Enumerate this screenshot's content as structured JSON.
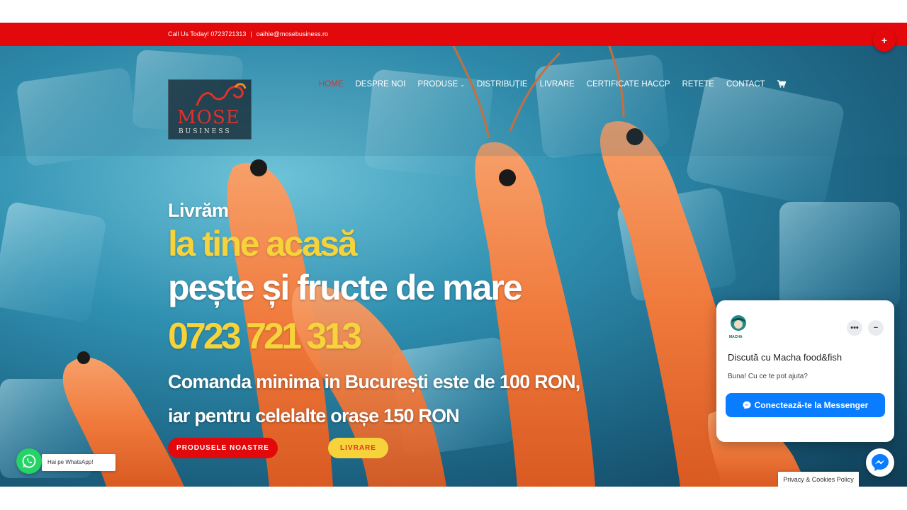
{
  "topbar": {
    "phone_text": "Call Us Today! 0723721313",
    "separator": "|",
    "email": "oaihie@mosebusiness.ro",
    "plus_label": "+"
  },
  "logo": {
    "main": "MOSE",
    "sub": "BUSINESS"
  },
  "nav": {
    "items": [
      {
        "label": "HOME",
        "active": true
      },
      {
        "label": "DESPRE NOI"
      },
      {
        "label": "PRODUSE",
        "has_dropdown": true
      },
      {
        "label": "DISTRIBUȚIE"
      },
      {
        "label": "LIVRARE"
      },
      {
        "label": "CERTIFICATE HACCP"
      },
      {
        "label": "RETETE"
      },
      {
        "label": "CONTACT"
      }
    ],
    "cart_icon": "cart-icon"
  },
  "hero": {
    "line1": "Livrăm",
    "line2": "la tine acasă",
    "line3": "pește și fructe de mare",
    "phone": "0723 721 313",
    "line4": "Comanda minima in București este de 100 RON,",
    "line5": "iar pentru celelalte orașe 150 RON",
    "btn_products": "PRODUSELE NOASTRE",
    "btn_delivery": "LIVRARE"
  },
  "whatsapp": {
    "label": "Hai pe WhatsApp!"
  },
  "chat": {
    "avatar_text": "MACHA",
    "title": "Discută cu Macha food&fish",
    "message": "Buna! Cu ce te pot ajuta?",
    "button": "Conectează-te la Messenger",
    "more_label": "•••",
    "minimize_label": "−"
  },
  "privacy": {
    "label": "Privacy & Cookies Policy"
  },
  "colors": {
    "accent_red": "#e3080b",
    "accent_yellow": "#f6d33a",
    "messenger_blue": "#0a7cff",
    "whatsapp_green": "#25d366"
  }
}
